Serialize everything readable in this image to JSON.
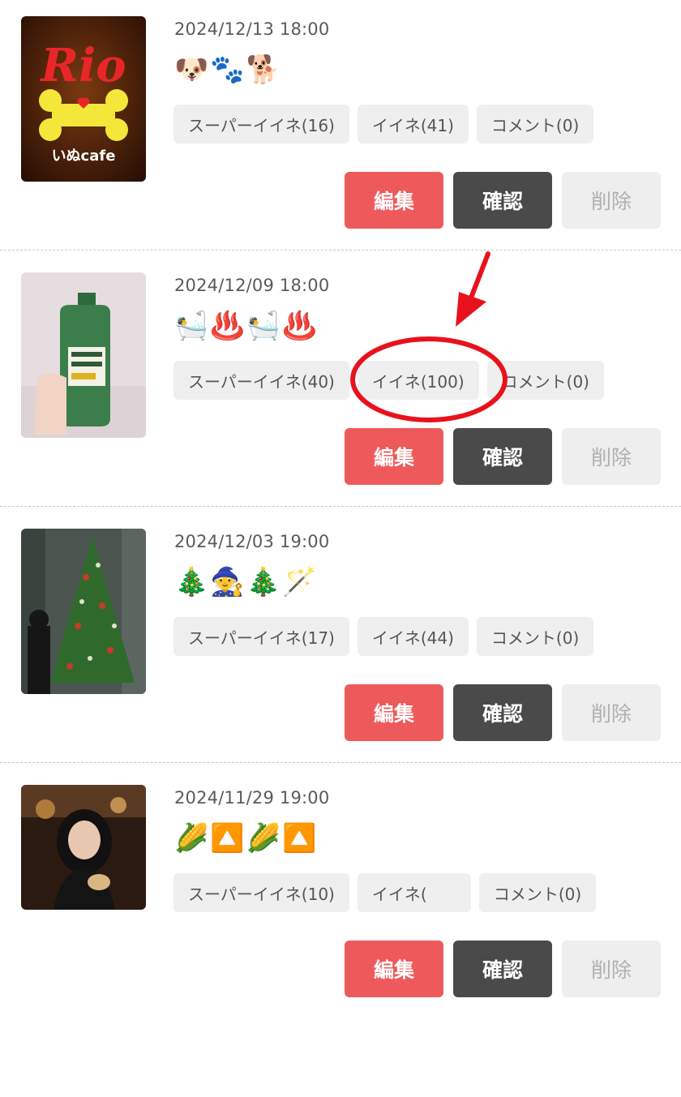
{
  "buttons": {
    "edit": "編集",
    "confirm": "確認",
    "delete": "削除"
  },
  "posts": [
    {
      "datetime": "2024/12/13 18:00",
      "emoji": "🐶🐾🐕",
      "thumbnail": {
        "icon": "rio-inu-cafe-sign",
        "text_brand": "Rio",
        "text_sub": "いぬcafe"
      },
      "stats": {
        "super_like": "スーパーイイネ(16)",
        "like": "イイネ(41)",
        "comment": "コメント(0)"
      }
    },
    {
      "datetime": "2024/12/09 18:00",
      "emoji": "🛀♨️🛀♨️",
      "thumbnail": {
        "icon": "bath-liquid-bottle-photo"
      },
      "stats": {
        "super_like": "スーパーイイネ(40)",
        "like": "イイネ(100)",
        "comment": "コメント(0)"
      }
    },
    {
      "datetime": "2024/12/03 19:00",
      "emoji": "🎄🧙🎄🪄",
      "thumbnail": {
        "icon": "christmas-tree-photo"
      },
      "stats": {
        "super_like": "スーパーイイネ(17)",
        "like": "イイネ(44)",
        "comment": "コメント(0)"
      }
    },
    {
      "datetime": "2024/11/29 19:00",
      "emoji": "🌽🔼🌽🔼",
      "thumbnail": {
        "icon": "portrait-photo"
      },
      "stats": {
        "super_like": "スーパーイイネ(10)",
        "like": "イイネ(",
        "comment": "コメント(0)"
      }
    }
  ],
  "colors": {
    "edit_button": "#ee5a5c",
    "confirm_button": "#4a4a4a",
    "delete_button": "#eeeeee",
    "chip_background": "#efefef",
    "annotation": "#e8121c"
  },
  "annotation": {
    "icon": "red-arrow-and-circle-highlight"
  }
}
